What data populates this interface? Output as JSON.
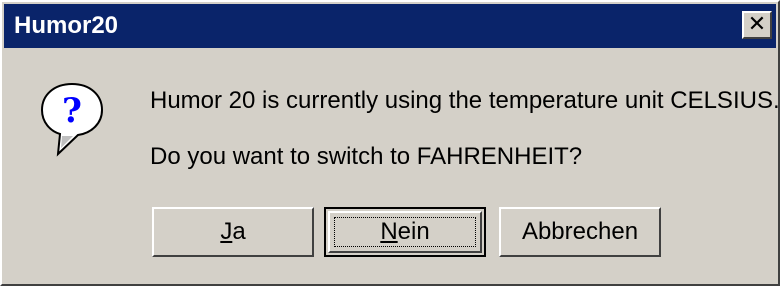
{
  "window": {
    "title": "Humor20",
    "close_glyph": "✕"
  },
  "icon": {
    "name": "question-icon",
    "glyph": "?",
    "colors": {
      "bubble": "#ffffff",
      "mark": "#0000ff"
    }
  },
  "message": {
    "line1": "Humor 20 is currently using the temperature unit CELSIUS.",
    "line2": "Do you want to switch to FAHRENHEIT?"
  },
  "buttons": {
    "yes": {
      "mnemonic": "J",
      "rest": "a"
    },
    "no": {
      "mnemonic": "N",
      "rest": "ein"
    },
    "cancel": {
      "label": "Abbrechen"
    }
  },
  "colors": {
    "titlebar": "#0a246a",
    "face": "#d4d0c8"
  }
}
